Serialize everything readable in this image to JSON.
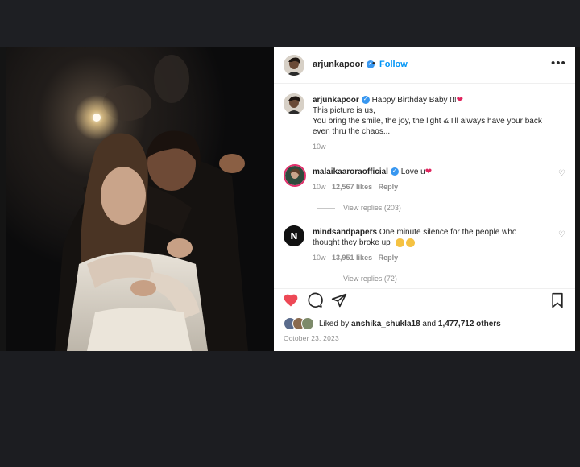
{
  "post": {
    "username": "arjunkapoor",
    "follow_label": "Follow",
    "separator": "•",
    "more_label": "•••"
  },
  "caption": {
    "username": "arjunkapoor",
    "line1": "Happy Birthday Baby !!!",
    "line2": "This picture is us,",
    "line3": "You bring the smile, the joy, the light & I'll always have your back",
    "line4": "even thru the chaos...",
    "time": "10w"
  },
  "comments": [
    {
      "username": "malaikaaroraofficial",
      "text": "Love u",
      "time": "10w",
      "likes": "12,567 likes",
      "reply_label": "Reply",
      "view_replies": "View replies (203)"
    },
    {
      "username": "mindsandpapers",
      "text_line1": "One minute silence for the people who",
      "text_line2": "thought they broke up",
      "time": "10w",
      "likes": "13,951 likes",
      "reply_label": "Reply",
      "view_replies": "View replies (72)"
    }
  ],
  "likes": {
    "prefix": "Liked by",
    "user": "anshika_shukla18",
    "middle": "and",
    "count": "1,477,712 others"
  },
  "date": "October 23, 2023",
  "colors": {
    "like_active": "#ed4956",
    "verified": "#3897f0",
    "follow": "#0095f6"
  },
  "icons": [
    "heart-icon",
    "comment-icon",
    "share-icon",
    "bookmark-icon",
    "more-icon",
    "verified-icon"
  ]
}
